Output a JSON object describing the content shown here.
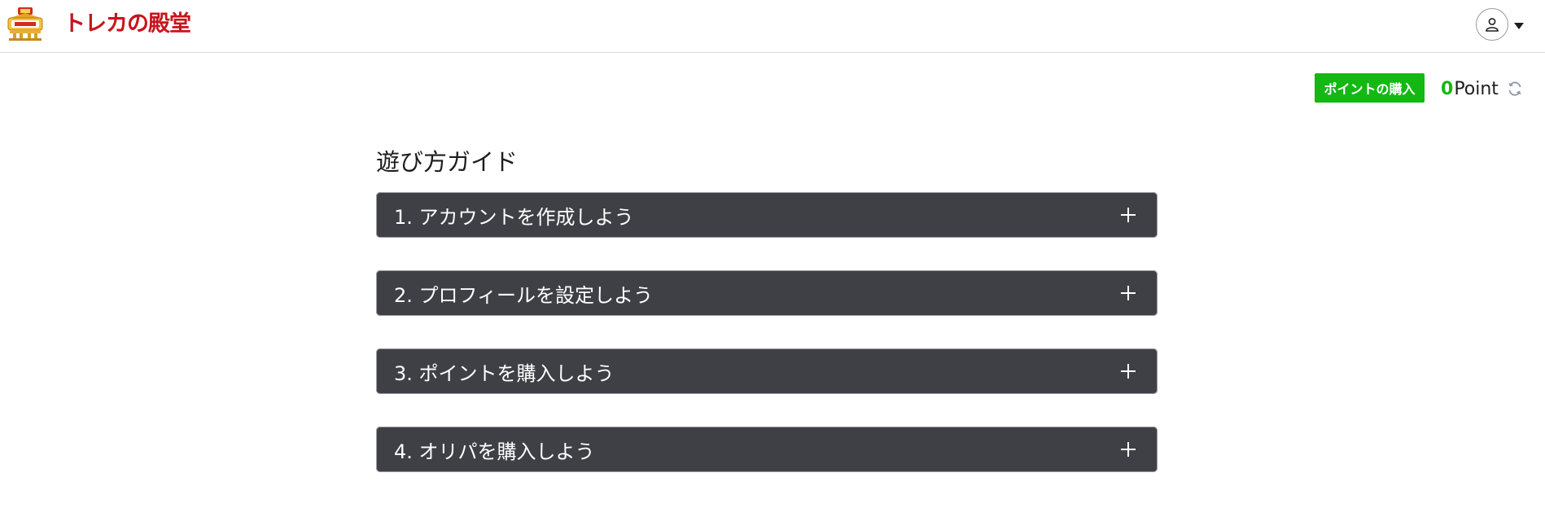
{
  "header": {
    "logo_badge_text": "トレカの殿堂",
    "logo_text": "トレカの殿堂",
    "user_icon": "user-icon",
    "caret_icon": "caret-down-icon"
  },
  "points_bar": {
    "buy_label": "ポイントの購入",
    "value": "0",
    "unit": "Point",
    "refresh_icon": "refresh-icon"
  },
  "guide": {
    "title": "遊び方ガイド",
    "items": [
      {
        "label": "1. アカウントを作成しよう",
        "icon": "plus-icon"
      },
      {
        "label": "2. プロフィールを設定しよう",
        "icon": "plus-icon"
      },
      {
        "label": "3. ポイントを購入しよう",
        "icon": "plus-icon"
      },
      {
        "label": "4. オリパを購入しよう",
        "icon": "plus-icon"
      }
    ]
  },
  "colors": {
    "accent_green": "#13b813",
    "brand_red": "#c8141c",
    "accordion_bg": "#3f4046"
  }
}
